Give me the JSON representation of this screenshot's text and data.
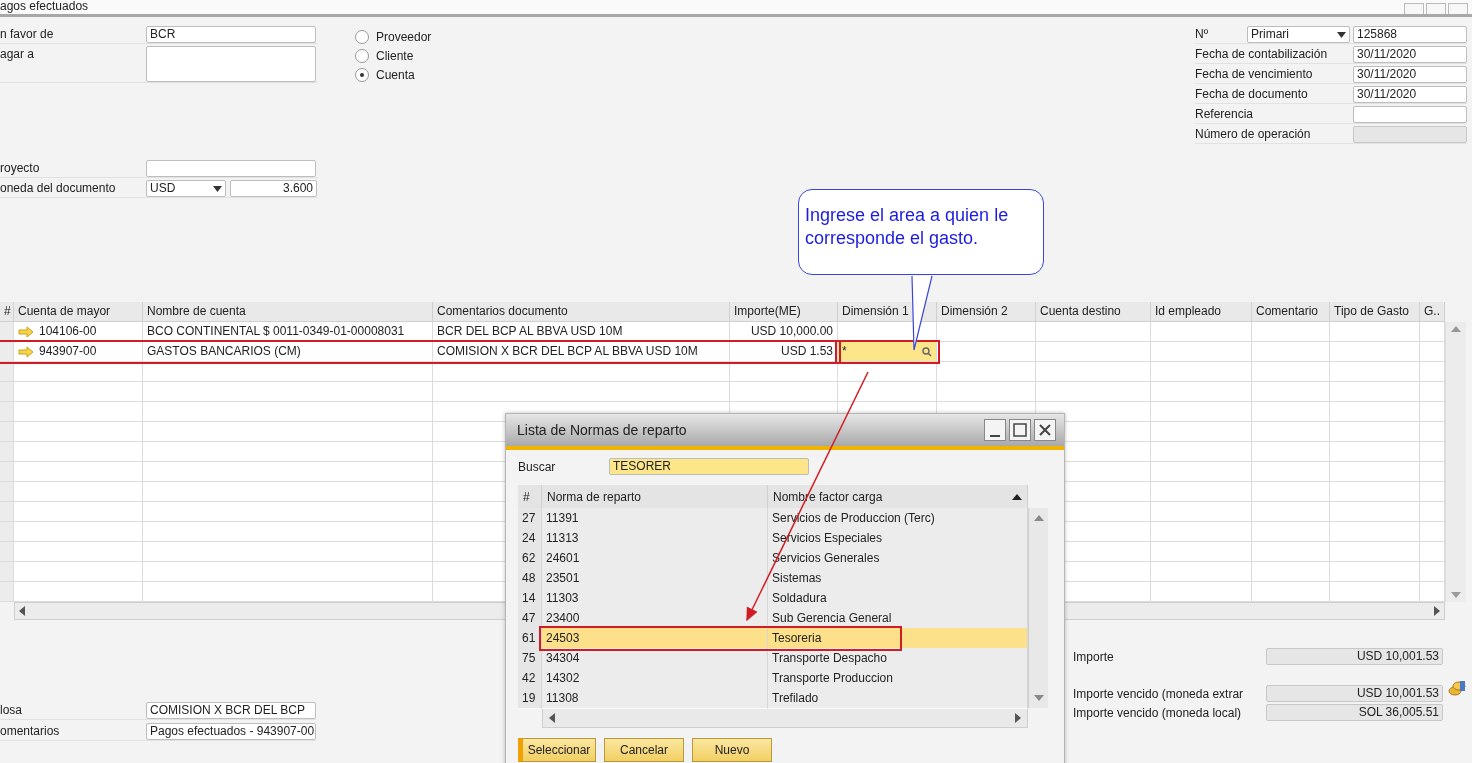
{
  "window": {
    "title": "agos efectuados"
  },
  "header_left": [
    {
      "kind": "text",
      "label": "n favor de",
      "value": "BCR"
    },
    {
      "kind": "textarea",
      "label": "agar a"
    },
    {
      "kind": "text",
      "label": "royecto"
    },
    {
      "kind": "currency",
      "label": "oneda del documento",
      "value": "USD",
      "rate": "3.600"
    }
  ],
  "payee_type": [
    {
      "label": "Proveedor",
      "selected": false
    },
    {
      "label": "Cliente",
      "selected": false
    },
    {
      "label": "Cuenta",
      "selected": true
    }
  ],
  "header_right": [
    {
      "kind": "series",
      "label": "Nº",
      "series": "Primari",
      "value": "125868"
    },
    {
      "kind": "text",
      "label": "Fecha de contabilización",
      "value": "30/11/2020"
    },
    {
      "kind": "text",
      "label": "Fecha de vencimiento",
      "value": "30/11/2020"
    },
    {
      "kind": "text",
      "label": "Fecha de documento",
      "value": "30/11/2020"
    },
    {
      "kind": "text",
      "label": "Referencia"
    },
    {
      "kind": "readonly",
      "label": "Número de operación"
    }
  ],
  "table": {
    "columns": [
      "#",
      "Cuenta de mayor",
      "Nombre de cuenta",
      "Comentarios documento",
      "Importe(ME)",
      "Dimensión 1",
      "Dimensión 2",
      "Cuenta destino",
      "Id empleado",
      "Comentario",
      "Tipo de Gasto",
      "G.."
    ],
    "rows": [
      {
        "outlined": false,
        "cells": [
          {
            "text": ""
          },
          {
            "text": "104106-00"
          },
          {
            "text": "BCO CONTINENTAL $ 0011-0349-01-00008031"
          },
          {
            "text": "BCR DEL BCP AL BBVA USD 10M"
          },
          {
            "text": "USD 10,000.00"
          }
        ]
      },
      {
        "outlined": true,
        "cells": [
          {
            "text": ""
          },
          {
            "text": "943907-00"
          },
          {
            "text": "GASTOS BANCARIOS (CM)"
          },
          {
            "text": "COMISION X BCR DEL BCP AL BBVA USD 10M"
          },
          {
            "text": "USD 1.53"
          },
          {
            "text": "*",
            "kind": "lookup",
            "outlined": true
          }
        ]
      }
    ]
  },
  "callout": {
    "text": "Ingrese el area a quien le corresponde el gasto."
  },
  "dialog": {
    "title": "Lista de Normas de reparto",
    "search_label": "Buscar",
    "search_value": "TESORER",
    "columns": [
      "#",
      "Norma de reparto",
      "Nombre factor carga"
    ],
    "rows": [
      {
        "num": "27",
        "code": "11391",
        "name": "Servicios de Produccion (Terc)",
        "selected": false,
        "outlined": false
      },
      {
        "num": "24",
        "code": "11313",
        "name": "Servicios Especiales",
        "selected": false,
        "outlined": false
      },
      {
        "num": "62",
        "code": "24601",
        "name": "Servicios Generales",
        "selected": false,
        "outlined": false
      },
      {
        "num": "48",
        "code": "23501",
        "name": "Sistemas",
        "selected": false,
        "outlined": false
      },
      {
        "num": "14",
        "code": "11303",
        "name": "Soldadura",
        "selected": false,
        "outlined": false
      },
      {
        "num": "47",
        "code": "23400",
        "name": "Sub Gerencia General",
        "selected": false,
        "outlined": false
      },
      {
        "num": "61",
        "code": "24503",
        "name": "Tesoreria",
        "selected": true,
        "outlined": true
      },
      {
        "num": "75",
        "code": "34304",
        "name": "Transporte Despacho",
        "selected": false,
        "outlined": false
      },
      {
        "num": "42",
        "code": "14302",
        "name": "Transporte Produccion",
        "selected": false,
        "outlined": false
      },
      {
        "num": "19",
        "code": "11308",
        "name": "Trefilado",
        "selected": false,
        "outlined": false
      }
    ],
    "buttons": [
      {
        "label": "Seleccionar",
        "focused": true
      },
      {
        "label": "Cancelar",
        "focused": false
      },
      {
        "label": "Nuevo",
        "focused": false
      }
    ]
  },
  "footer_left": [
    {
      "label": "losa",
      "value": "COMISION X BCR DEL BCP"
    },
    {
      "label": "omentarios",
      "value": "Pagos efectuados - 943907-00"
    }
  ],
  "totals": [
    {
      "kind": "plain",
      "label": "Importe",
      "value": "USD 10,001.53"
    },
    {
      "kind": "coins",
      "label": "Importe vencido (moneda extrar",
      "value": "USD 10,001.53"
    },
    {
      "kind": "plain",
      "label": "Importe vencido (moneda local)",
      "value": "SOL 36,005.51"
    }
  ]
}
